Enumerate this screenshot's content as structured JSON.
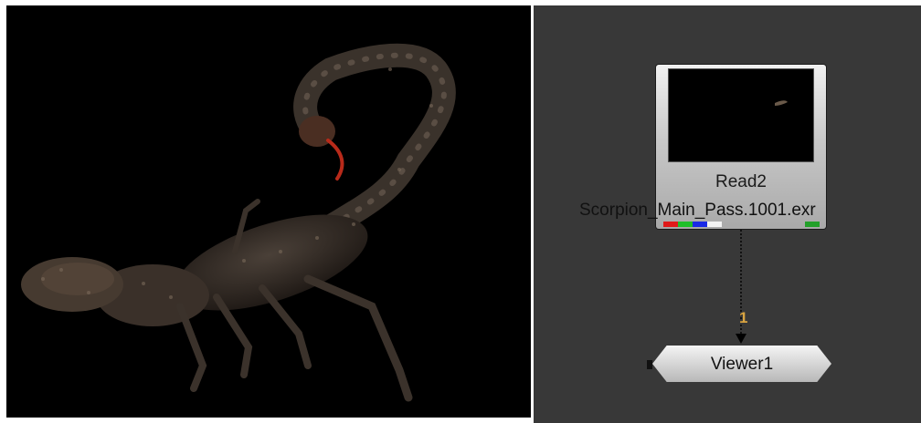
{
  "viewer": {
    "image": "scorpion-render"
  },
  "node_graph": {
    "read_node": {
      "title": "Read2",
      "filename": "Scorpion_Main_Pass.1001.exr",
      "channel_colors": [
        "#e01a1a",
        "#1fbf2a",
        "#1a2ae6",
        "#f2f2f2"
      ],
      "extra_channel_color": "#23a02a"
    },
    "connection": {
      "input_number": "1"
    },
    "viewer_node": {
      "title": "Viewer1"
    }
  }
}
